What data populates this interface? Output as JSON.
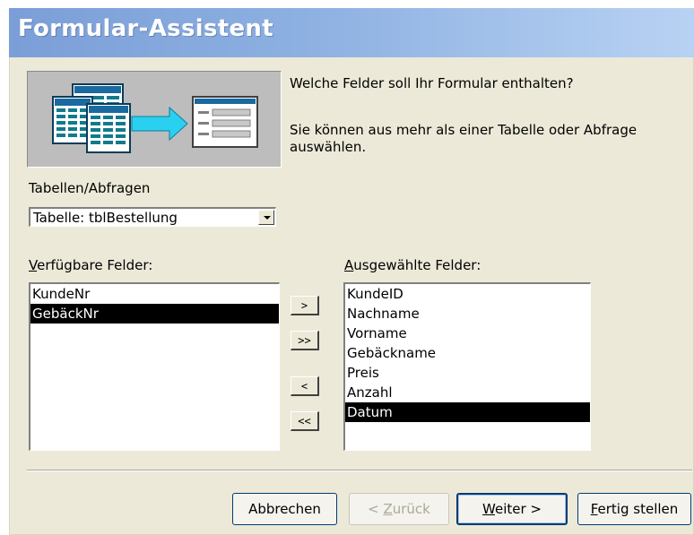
{
  "window": {
    "title": "Formular-Assistent"
  },
  "intro": {
    "question": "Welche Felder soll Ihr Formular enthalten?",
    "hint_line1": "Sie können aus mehr als einer Tabelle oder Abfrage",
    "hint_line2": "auswählen."
  },
  "source": {
    "label": "Tabellen/Abfragen",
    "selected": "Tabelle: tblBestellung"
  },
  "available": {
    "label_accel": "V",
    "label_rest": "erfügbare Felder:",
    "items": [
      "KundeNr",
      "GebäckNr"
    ],
    "selected_index": 1
  },
  "chosen": {
    "label_accel": "A",
    "label_rest": "usgewählte Felder:",
    "items": [
      "KundeID",
      "Nachname",
      "Vorname",
      "Gebäckname",
      "Preis",
      "Anzahl",
      "Datum"
    ],
    "selected_index": 6
  },
  "move_buttons": {
    "add_one": ">",
    "add_all": ">>",
    "remove_one": "<",
    "remove_all": "<<"
  },
  "footer": {
    "cancel": "Abbrechen",
    "back_pre": "< ",
    "back_accel": "Z",
    "back_rest": "urück",
    "next_accel": "W",
    "next_rest": "eiter >",
    "finish_accel": "F",
    "finish_rest": "ertig stellen"
  },
  "colors": {
    "title_gradient_start": "#7b9ed8",
    "title_gradient_end": "#b8d2f3",
    "dialog_bg": "#ece9d8",
    "selection_bg": "#000000"
  }
}
